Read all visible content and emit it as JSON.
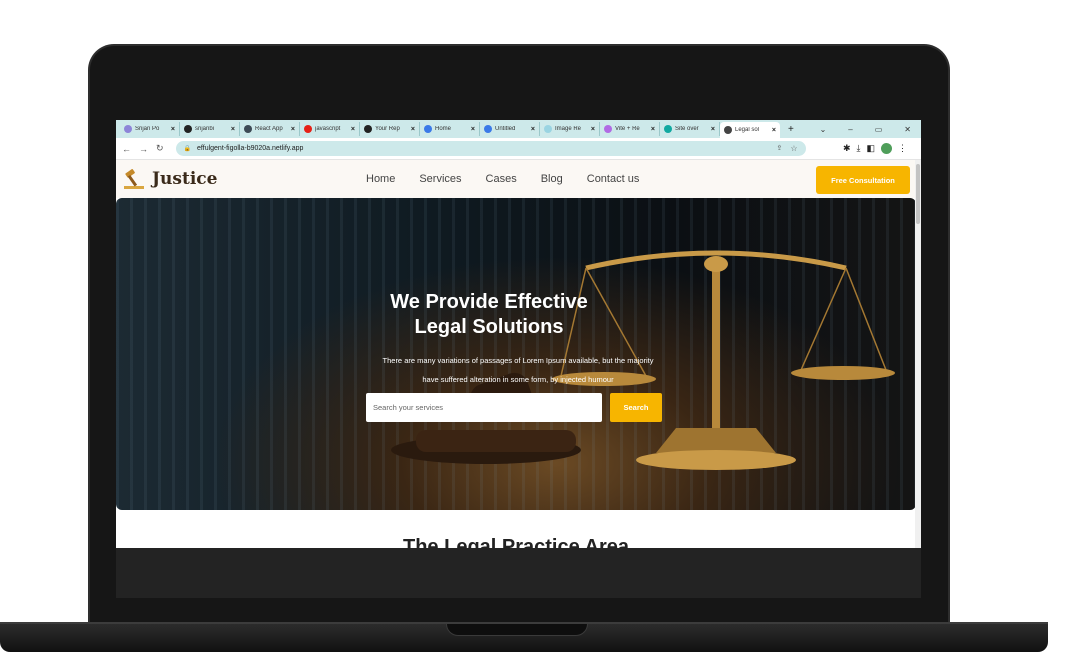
{
  "browser": {
    "tabs": [
      {
        "label": "Srijan Po",
        "color": "#8d84d8"
      },
      {
        "label": "srijanbi",
        "color": "#222222"
      },
      {
        "label": "React App",
        "color": "#3d4a55"
      },
      {
        "label": "javascript",
        "color": "#e62117"
      },
      {
        "label": "Your Rep",
        "color": "#222222"
      },
      {
        "label": "Home",
        "color": "#3b7ae8"
      },
      {
        "label": "Untitled",
        "color": "#3b7ae8"
      },
      {
        "label": "Image Re",
        "color": "#9ad4e2"
      },
      {
        "label": "Vite + Re",
        "color": "#b16be4"
      },
      {
        "label": "Site over",
        "color": "#12a9a1"
      },
      {
        "label": "Legal sol",
        "color": "#444444"
      }
    ],
    "new_tab_icon": "plus-icon",
    "url": "effulgent-figolla-b9020a.netlify.app"
  },
  "site": {
    "brand": "Justice",
    "nav": [
      "Home",
      "Services",
      "Cases",
      "Blog",
      "Contact us"
    ],
    "cta": "Free Consultation",
    "hero": {
      "title_line1": "We Provide Effective",
      "title_line2": "Legal Solutions",
      "desc_line1": "There are many variations of passages of Lorem Ipsum available, but the majority",
      "desc_line2": "have suffered alteration in some form, by injected humour",
      "search_placeholder": "Search your services",
      "search_button": "Search"
    },
    "section_heading": "The Legal Practice Area"
  },
  "colors": {
    "accent": "#f7b500",
    "tabbar": "#cde9ea"
  }
}
